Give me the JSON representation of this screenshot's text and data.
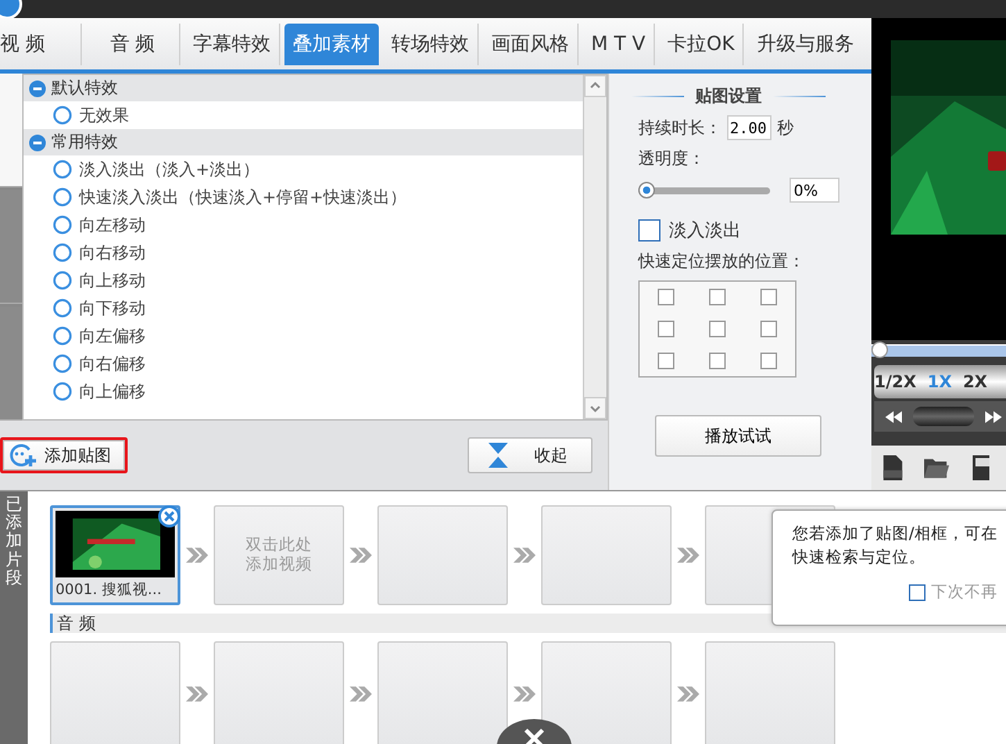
{
  "tabs": [
    {
      "label": "视 频",
      "selected": false
    },
    {
      "label": "音 频",
      "selected": false
    },
    {
      "label": "字幕特效",
      "selected": false
    },
    {
      "label": "叠加素材",
      "selected": true
    },
    {
      "label": "转场特效",
      "selected": false
    },
    {
      "label": "画面风格",
      "selected": false
    },
    {
      "label": "M T V",
      "selected": false
    },
    {
      "label": "卡拉OK",
      "selected": false
    },
    {
      "label": "升级与服务",
      "selected": false
    }
  ],
  "effect_groups": [
    {
      "title": "默认特效",
      "expanded": true,
      "items": [
        {
          "label": "无效果",
          "selected": false
        }
      ]
    },
    {
      "title": "常用特效",
      "expanded": true,
      "items": [
        {
          "label": "淡入淡出（淡入+淡出）",
          "selected": false
        },
        {
          "label": "快速淡入淡出（快速淡入+停留+快速淡出）",
          "selected": false
        },
        {
          "label": "向左移动",
          "selected": false
        },
        {
          "label": "向右移动",
          "selected": false
        },
        {
          "label": "向上移动",
          "selected": false
        },
        {
          "label": "向下移动",
          "selected": false
        },
        {
          "label": "向左偏移",
          "selected": false
        },
        {
          "label": "向右偏移",
          "selected": false
        },
        {
          "label": "向上偏移",
          "selected": false
        }
      ]
    }
  ],
  "bottom_buttons": [
    {
      "label": "添加贴图",
      "kind": "add",
      "highlighted": true
    },
    {
      "label": "收起",
      "kind": "collapse",
      "highlighted": false
    }
  ],
  "settings": {
    "title": "贴图设置",
    "duration_label": "持续时长：",
    "duration": "2.00",
    "duration_unit": "秒",
    "opacity_label": "透明度：",
    "opacity": {
      "level": 0
    },
    "opacity_value": "0%",
    "fade": {
      "label": "淡入淡出",
      "checked": false
    },
    "position_label": "快速定位摆放的位置：",
    "position_grid": [
      false,
      false,
      false,
      false,
      false,
      false,
      false,
      false,
      false
    ],
    "play_button": "播放试试"
  },
  "preview": {
    "progress": {
      "level": 0
    },
    "speeds": [
      {
        "label": "1/2X",
        "selected": false
      },
      {
        "label": "1X",
        "selected": true
      },
      {
        "label": "2X",
        "selected": false
      }
    ]
  },
  "side_tabs": [
    {
      "selected": true
    },
    {
      "selected": false
    },
    {
      "selected": false
    }
  ],
  "timeline": {
    "side_label": "已添加片段",
    "video_clips": [
      {
        "kind": "video",
        "caption": "0001. 搜狐视..."
      },
      {
        "kind": "add",
        "lines": [
          "双击此处",
          "添加视频"
        ]
      },
      {
        "kind": "empty"
      },
      {
        "kind": "empty"
      },
      {
        "kind": "empty"
      }
    ],
    "audio_label": "音 频",
    "audio_clips": [
      {
        "kind": "empty"
      },
      {
        "kind": "empty"
      },
      {
        "kind": "empty"
      },
      {
        "kind": "empty"
      },
      {
        "kind": "empty"
      }
    ]
  },
  "tip": {
    "lines": [
      "您若添加了贴图/相框，可在",
      "快速检索与定位。"
    ],
    "checkbox": {
      "label": "下次不再",
      "checked": false
    }
  }
}
